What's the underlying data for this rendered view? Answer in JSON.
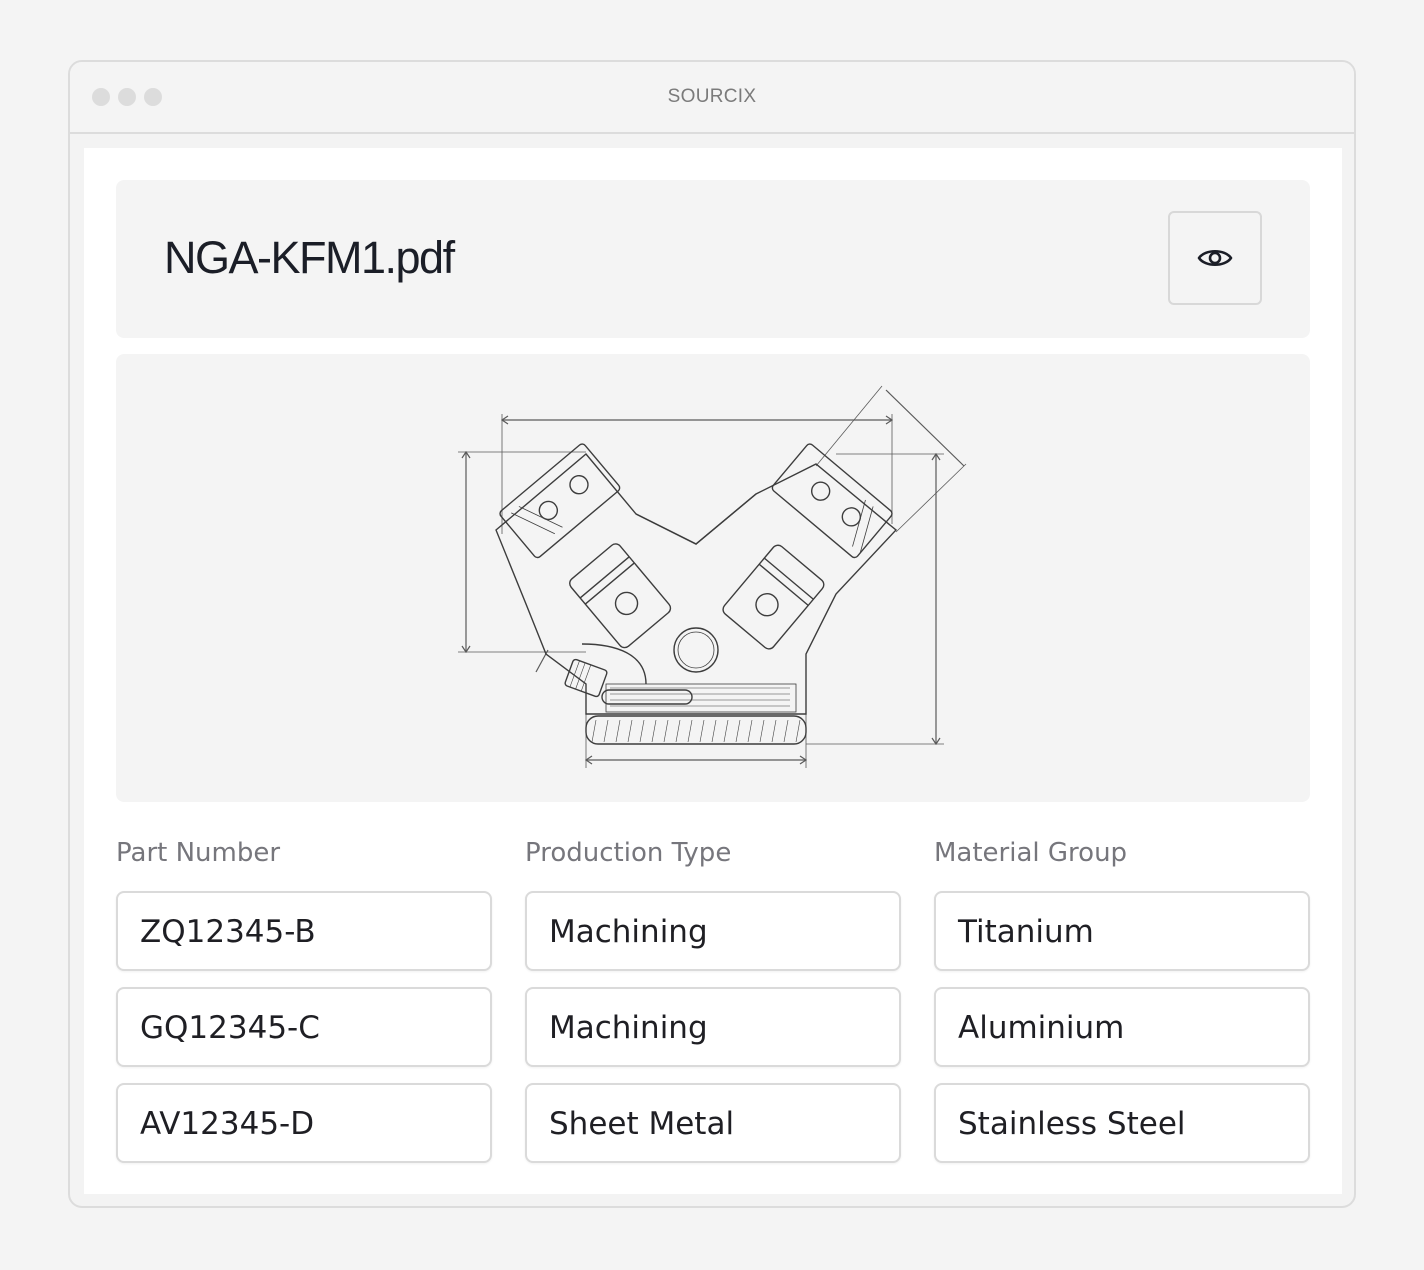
{
  "window": {
    "title": "SOURCIX"
  },
  "file": {
    "name": "NGA-KFM1.pdf",
    "preview_icon": "eye-icon"
  },
  "columns": {
    "part_number": "Part Number",
    "production_type": "Production Type",
    "material_group": "Material Group"
  },
  "rows": [
    {
      "part_number": "ZQ12345-B",
      "production_type": "Machining",
      "material_group": "Titanium"
    },
    {
      "part_number": "GQ12345-C",
      "production_type": "Machining",
      "material_group": "Aluminium"
    },
    {
      "part_number": "AV12345-D",
      "production_type": "Sheet Metal",
      "material_group": "Stainless Steel"
    }
  ]
}
